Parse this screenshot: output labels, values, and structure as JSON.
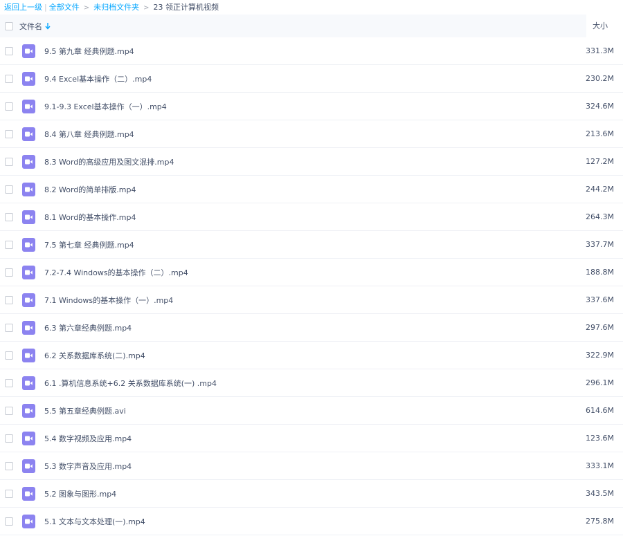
{
  "breadcrumb": {
    "back": "返回上一级",
    "all_files": "全部文件",
    "folder": "未归档文件夹",
    "current": "23 领正计算机视频",
    "separator": ">"
  },
  "header": {
    "name_label": "文件名",
    "size_label": "大小"
  },
  "icons": {
    "file": "video-file-icon",
    "sort": "arrow-down-icon",
    "accent": "#8c83f0",
    "link": "#06a7ff"
  },
  "files": [
    {
      "name": "9.5 第九章 经典例题.mp4",
      "size": "331.3M"
    },
    {
      "name": "9.4 Excel基本操作（二）.mp4",
      "size": "230.2M"
    },
    {
      "name": "9.1-9.3 Excel基本操作（一）.mp4",
      "size": "324.6M"
    },
    {
      "name": "8.4 第八章 经典例题.mp4",
      "size": "213.6M"
    },
    {
      "name": "8.3 Word的高级应用及图文混排.mp4",
      "size": "127.2M"
    },
    {
      "name": "8.2 Word的简单排版.mp4",
      "size": "244.2M"
    },
    {
      "name": "8.1 Word的基本操作.mp4",
      "size": "264.3M"
    },
    {
      "name": "7.5 第七章 经典例题.mp4",
      "size": "337.7M"
    },
    {
      "name": "7.2-7.4 Windows的基本操作（二）.mp4",
      "size": "188.8M"
    },
    {
      "name": "7.1 Windows的基本操作（一）.mp4",
      "size": "337.6M"
    },
    {
      "name": "6.3 第六章经典例题.mp4",
      "size": "297.6M"
    },
    {
      "name": "6.2 关系数据库系统(二).mp4",
      "size": "322.9M"
    },
    {
      "name": "6.1 .算机信息系统+6.2 关系数据库系统(一) .mp4",
      "size": "296.1M"
    },
    {
      "name": "5.5 第五章经典例题.avi",
      "size": "614.6M"
    },
    {
      "name": "5.4 数字视频及应用.mp4",
      "size": "123.6M"
    },
    {
      "name": "5.3 数字声音及应用.mp4",
      "size": "333.1M"
    },
    {
      "name": "5.2 图象与图形.mp4",
      "size": "343.5M"
    },
    {
      "name": "5.1 文本与文本处理(一).mp4",
      "size": "275.8M"
    }
  ]
}
